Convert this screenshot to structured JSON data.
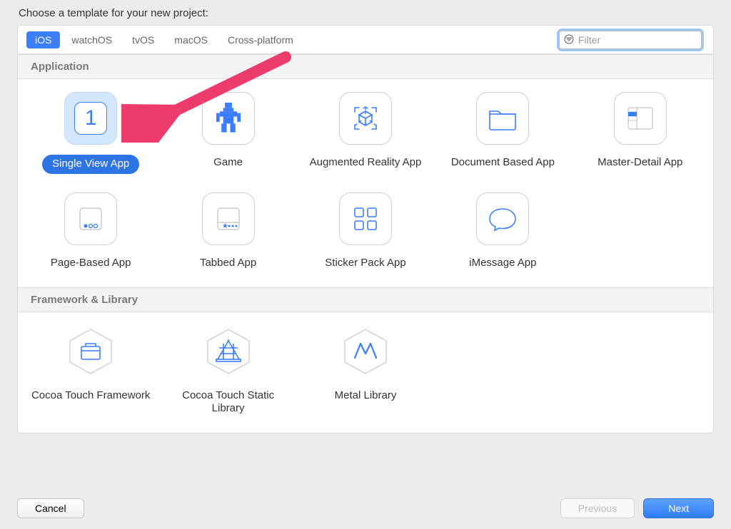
{
  "title": "Choose a template for your new project:",
  "platforms": [
    "iOS",
    "watchOS",
    "tvOS",
    "macOS",
    "Cross-platform"
  ],
  "active_platform": "iOS",
  "filter": {
    "placeholder": "Filter",
    "value": ""
  },
  "sections": {
    "application": {
      "title": "Application",
      "templates": [
        {
          "label": "Single View App",
          "icon": "single-view",
          "selected": true
        },
        {
          "label": "Game",
          "icon": "game"
        },
        {
          "label": "Augmented Reality App",
          "icon": "augmented-reality"
        },
        {
          "label": "Document Based App",
          "icon": "document"
        },
        {
          "label": "Master-Detail App",
          "icon": "master-detail"
        },
        {
          "label": "Page-Based App",
          "icon": "page-based"
        },
        {
          "label": "Tabbed App",
          "icon": "tabbed"
        },
        {
          "label": "Sticker Pack App",
          "icon": "sticker-pack"
        },
        {
          "label": "iMessage App",
          "icon": "imessage"
        }
      ]
    },
    "framework": {
      "title": "Framework & Library",
      "templates": [
        {
          "label": "Cocoa Touch Framework",
          "icon": "framework",
          "shape": "hex"
        },
        {
          "label": "Cocoa Touch Static Library",
          "icon": "static-library",
          "shape": "hex"
        },
        {
          "label": "Metal Library",
          "icon": "metal",
          "shape": "hex"
        }
      ]
    }
  },
  "footer": {
    "cancel": "Cancel",
    "previous": "Previous",
    "next": "Next"
  },
  "annotation": {
    "color": "#ef3b6b",
    "target": "Single View App"
  },
  "colors": {
    "accent": "#3a7dff",
    "selected_bg": "#d3e7ff",
    "arrow": "#ef3b6b"
  }
}
